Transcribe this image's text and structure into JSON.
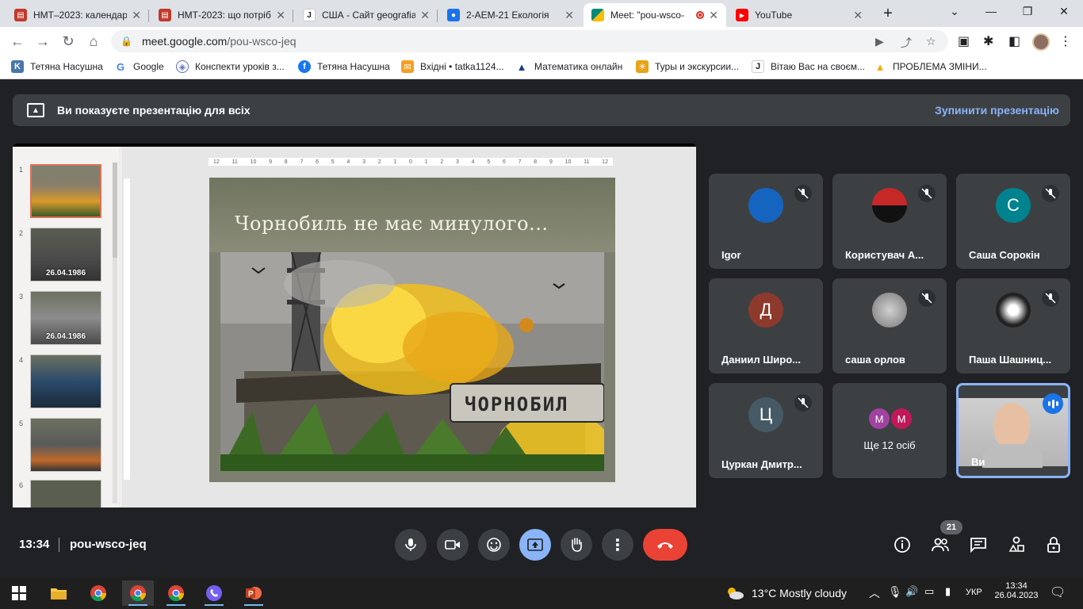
{
  "browser": {
    "tabs": [
      {
        "title": "НМТ–2023: календар",
        "icon": "book-icon",
        "color": "#c0392b"
      },
      {
        "title": "НМТ-2023: що потріб",
        "icon": "book-icon",
        "color": "#c0392b"
      },
      {
        "title": "США - Сайт geografia",
        "icon": "j-icon",
        "color": "#202124"
      },
      {
        "title": "2-АЕМ-21 Екологія",
        "icon": "classroom-icon",
        "color": "#1a73e8"
      },
      {
        "title": "Meet: \"pou-wsco-",
        "icon": "meet-icon",
        "color": "#00897b"
      },
      {
        "title": "YouTube",
        "icon": "youtube-icon",
        "color": "#ff0000"
      }
    ],
    "url_host": "meet.google.com",
    "url_path": "/pou-wsco-jeq",
    "bookmarks": [
      {
        "label": "Тетяна Насушна",
        "icon": "vk-icon",
        "color": "#4a76a8"
      },
      {
        "label": "Google",
        "icon": "google-icon",
        "color": "#4285f4"
      },
      {
        "label": "Конспекти уроків з...",
        "icon": "shield-icon",
        "color": "#5c6bc0"
      },
      {
        "label": "Тетяна Насушна",
        "icon": "facebook-icon",
        "color": "#1877f2"
      },
      {
        "label": "Вхідні • tatka1124...",
        "icon": "mail-icon",
        "color": "#f4a025"
      },
      {
        "label": "Математика онлайн",
        "icon": "triangle-icon",
        "color": "#1a3a8a"
      },
      {
        "label": "Туры и экскурсии...",
        "icon": "tour-icon",
        "color": "#e8a317"
      },
      {
        "label": "Вітаю Вас на своєм...",
        "icon": "j-icon",
        "color": "#202124"
      },
      {
        "label": "ПРОБЛЕМА ЗМІНИ...",
        "icon": "warning-icon",
        "color": "#f9ab00"
      }
    ]
  },
  "meet": {
    "banner_text": "Ви показуєте презентацію для всіх",
    "stop_label": "Зупинити презентацію",
    "slide_title": "Чорнобиль не має минулого...",
    "slide_sign_text": "ЧОРНОБИЛ",
    "ruler_ticks": [
      "12",
      "11",
      "10",
      "9",
      "8",
      "7",
      "6",
      "5",
      "4",
      "3",
      "2",
      "1",
      "0",
      "1",
      "2",
      "3",
      "4",
      "5",
      "6",
      "7",
      "8",
      "9",
      "10",
      "11",
      "12"
    ],
    "thumbnails": [
      {
        "num": "1",
        "label": ""
      },
      {
        "num": "2",
        "label": "26.04.1986"
      },
      {
        "num": "3",
        "label": "26.04.1986"
      },
      {
        "num": "4",
        "label": ""
      },
      {
        "num": "5",
        "label": ""
      },
      {
        "num": "6",
        "label": ""
      }
    ],
    "participants": [
      {
        "name": "Igor",
        "initial": "",
        "color": "#1565c0",
        "muted": true
      },
      {
        "name": "Користувач А...",
        "initial": "",
        "color": "#c62828",
        "muted": true
      },
      {
        "name": "Саша Сорокін",
        "initial": "С",
        "color": "#00838f",
        "muted": true
      },
      {
        "name": "Даниил Широ...",
        "initial": "Д",
        "color": "#8d3a2d",
        "muted": false
      },
      {
        "name": "саша орлов",
        "initial": "",
        "color": "#9e9e9e",
        "muted": true
      },
      {
        "name": "Паша Шашниц...",
        "initial": "",
        "color": "#212121",
        "muted": true
      },
      {
        "name": "Цуркан Дмитр...",
        "initial": "Ц",
        "color": "#455a64",
        "muted": true
      }
    ],
    "more": {
      "label": "Ще 12 осіб",
      "initials": [
        "M",
        "M"
      ],
      "color": "#a142a0"
    },
    "self_label": "Ви",
    "time": "13:34",
    "meeting_code": "pou-wsco-jeq",
    "participant_count": "21"
  },
  "taskbar": {
    "weather": "13°C  Mostly cloudy",
    "lang": "УКР",
    "time": "13:34",
    "date": "26.04.2023"
  }
}
